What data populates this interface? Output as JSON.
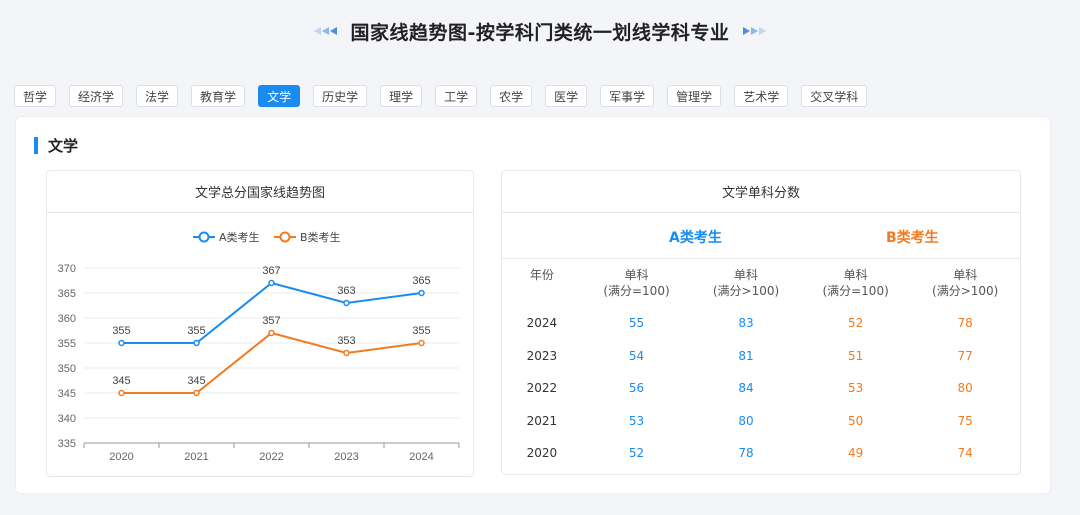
{
  "page_title": "国家线趋势图-按学科门类统一划线学科专业",
  "tabs": [
    {
      "label": "哲学",
      "active": false
    },
    {
      "label": "经济学",
      "active": false
    },
    {
      "label": "法学",
      "active": false
    },
    {
      "label": "教育学",
      "active": false
    },
    {
      "label": "文学",
      "active": true
    },
    {
      "label": "历史学",
      "active": false
    },
    {
      "label": "理学",
      "active": false
    },
    {
      "label": "工学",
      "active": false
    },
    {
      "label": "农学",
      "active": false
    },
    {
      "label": "医学",
      "active": false
    },
    {
      "label": "军事学",
      "active": false
    },
    {
      "label": "管理学",
      "active": false
    },
    {
      "label": "艺术学",
      "active": false
    },
    {
      "label": "交叉学科",
      "active": false
    }
  ],
  "section_title": "文学",
  "chart_panel_title": "文学总分国家线趋势图",
  "chart_data": {
    "type": "line",
    "x": [
      "2020",
      "2021",
      "2022",
      "2023",
      "2024"
    ],
    "series": [
      {
        "name": "A类考生",
        "color": "#1a8bf0",
        "values": [
          355,
          355,
          367,
          363,
          365
        ]
      },
      {
        "name": "B类考生",
        "color": "#f47a1f",
        "values": [
          345,
          345,
          357,
          353,
          355
        ]
      }
    ],
    "ylim": [
      335,
      370
    ],
    "yticks": [
      335,
      340,
      345,
      350,
      355,
      360,
      365,
      370
    ],
    "legend": "top-center",
    "grid": true
  },
  "table_panel": {
    "title": "文学单科分数",
    "group_a": "A类考生",
    "group_b": "B类考生",
    "columns": [
      "年份",
      "单科\n(满分=100)",
      "单科\n(满分>100)",
      "单科\n(满分=100)",
      "单科\n(满分>100)"
    ],
    "rows": [
      [
        "2024",
        "55",
        "83",
        "52",
        "78"
      ],
      [
        "2023",
        "54",
        "81",
        "51",
        "77"
      ],
      [
        "2022",
        "56",
        "84",
        "53",
        "80"
      ],
      [
        "2021",
        "53",
        "80",
        "50",
        "75"
      ],
      [
        "2020",
        "52",
        "78",
        "49",
        "74"
      ]
    ]
  },
  "colors": {
    "accent": "#1a8bf0",
    "secondary": "#f47a1f"
  }
}
